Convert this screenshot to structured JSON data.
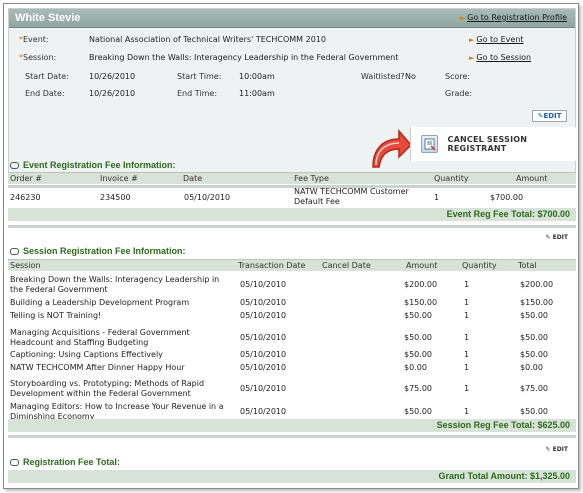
{
  "header": {
    "title": "White Stevie",
    "profile_link": "Go to Registration Profile",
    "event_label": "Event:",
    "event_value": "National Association of Technical Writers' TECHCOMM 2010",
    "event_link": "Go to Event",
    "session_label": "Session:",
    "session_value": "Breaking Down the Walls: Interagency Leadership in the Federal Government",
    "session_link": "Go to Session",
    "start_date_label": "Start Date:",
    "start_date": "10/26/2010",
    "start_time_label": "Start Time:",
    "start_time": "10:00am",
    "waitlisted_label": "Waitlisted?",
    "waitlisted": "No",
    "score_label": "Score:",
    "end_date_label": "End Date:",
    "end_date": "10/26/2010",
    "end_time_label": "End Time:",
    "end_time": "11:00am",
    "grade_label": "Grade:",
    "edit_label": "EDIT",
    "cancel_label": "CANCEL SESSION REGISTRANT"
  },
  "event_fee": {
    "title": "Event Registration Fee Information:",
    "columns": [
      "Order #",
      "Invoice #",
      "Date",
      "Fee Type",
      "Quantity",
      "Amount"
    ],
    "row": {
      "order": "246230",
      "invoice": "234500",
      "date": "05/10/2010",
      "fee_type": "NATW TECHCOMM Customer Default Fee",
      "quantity": "1",
      "amount": "$700.00"
    },
    "total": "Event Reg Fee Total:  $700.00"
  },
  "session_fee": {
    "edit_label": "EDIT",
    "title": "Session Registration Fee Information:",
    "columns": [
      "Session",
      "Transaction Date",
      "Cancel Date",
      "Amount",
      "Quantity",
      "Total"
    ],
    "rows": [
      {
        "session": "Breaking Down the Walls: Interagency Leadership in the Federal Government",
        "date": "05/10/2010",
        "amount": "$200.00",
        "qty": "1",
        "total": "$200.00"
      },
      {
        "session": "Building a Leadership Development Program",
        "date": "05/10/2010",
        "amount": "$150.00",
        "qty": "1",
        "total": "$150.00"
      },
      {
        "session": "Telling is NOT Training!",
        "date": "05/10/2010",
        "amount": "$50.00",
        "qty": "1",
        "total": "$50.00"
      },
      {
        "session": "Managing Acquisitions - Federal Government Headcount and Staffing Budgeting",
        "date": "05/10/2010",
        "amount": "$50.00",
        "qty": "1",
        "total": "$50.00"
      },
      {
        "session": "Captioning: Using Captions Effectively",
        "date": "05/10/2010",
        "amount": "$50.00",
        "qty": "1",
        "total": "$50.00"
      },
      {
        "session": "NATW TECHCOMM After Dinner Happy Hour",
        "date": "05/10/2010",
        "amount": "$0.00",
        "qty": "1",
        "total": "$0.00"
      },
      {
        "session": "Storyboarding vs. Prototyping: Methods of Rapid Development within the Federal Government",
        "date": "05/10/2010",
        "amount": "$75.00",
        "qty": "1",
        "total": "$75.00"
      },
      {
        "session": "Managing Editors: How to Increase Your Revenue in a Diminshing Economy",
        "date": "05/10/2010",
        "amount": "$50.00",
        "qty": "1",
        "total": "$50.00"
      }
    ],
    "total": "Session Reg Fee Total:  $625.00"
  },
  "reg_total": {
    "edit_label": "EDIT",
    "title": "Registration Fee Total:",
    "grand_total": "Grand Total Amount: $1,325.00"
  },
  "colors": {
    "accent_green": "#2d6a1e",
    "header_bar": "#8ea6a0",
    "grid_band": "#d7e3d6"
  }
}
